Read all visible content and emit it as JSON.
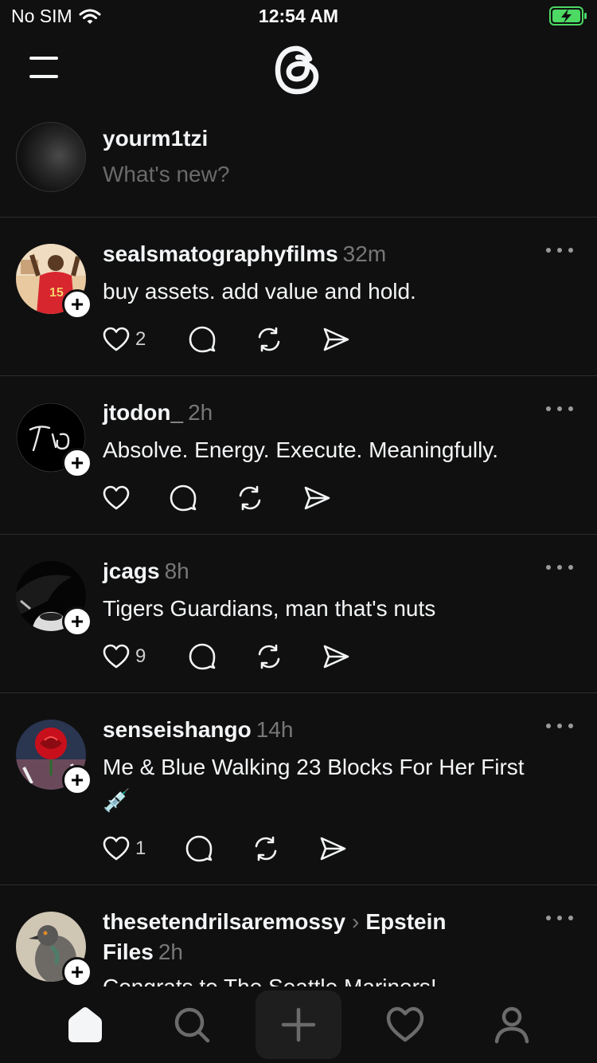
{
  "status_bar": {
    "carrier": "No SIM",
    "time": "12:54 AM",
    "battery_color": "#4cd964"
  },
  "header": {
    "menu_icon": "menu-icon",
    "logo_icon": "threads-logo-icon"
  },
  "composer": {
    "username": "yourm1tzi",
    "prompt": "What's new?"
  },
  "posts": [
    {
      "username": "sealsmatographyfilms",
      "time": "32m",
      "text": "buy assets. add value and hold.",
      "likes": "2",
      "avatar": "football-player-avatar"
    },
    {
      "username": "jtodon_",
      "time": "2h",
      "text": "Absolve. Energy. Execute. Meaningfully.",
      "likes": "",
      "avatar": "monogram-avatar"
    },
    {
      "username": "jcags",
      "time": "8h",
      "text": "Tigers Guardians, man that's nuts",
      "likes": "9",
      "avatar": "dark-photo-avatar"
    },
    {
      "username": "senseishango",
      "time": "14h",
      "text": "Me & Blue Walking 23 Blocks For Her First",
      "text_line2": "💉",
      "likes": "1",
      "avatar": "rose-avatar"
    },
    {
      "username": "thesetendrilsaremossy",
      "topic": "Epstein",
      "topic_line2": "Files",
      "time": "2h",
      "text": "Congrats to The Seattle Mariners!",
      "avatar": "pigeon-avatar"
    }
  ],
  "bottom_nav": {
    "items": [
      "home-icon",
      "search-icon",
      "compose-icon",
      "heart-icon",
      "profile-icon"
    ]
  }
}
